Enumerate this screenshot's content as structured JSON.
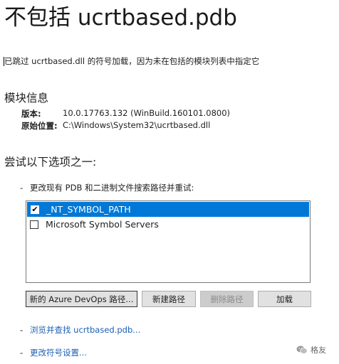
{
  "header": {
    "title": "不包括 ucrtbased.pdb"
  },
  "description": "已跳过 ucrtbased.dll 的符号加载，因为未在包括的模块列表中指定它",
  "module_info": {
    "heading": "模块信息",
    "version_label": "版本:",
    "version_value": "10.0.17763.132 (WinBuild.160101.0800)",
    "location_label": "原始位置:",
    "location_value": "C:\\Windows\\System32\\ucrtbased.dll"
  },
  "options": {
    "heading": "尝试以下选项之一:",
    "bullet_dash": "-",
    "change_paths_text": "更改现有 PDB 和二进制文件搜索路径并重试:",
    "list_items": [
      {
        "label": "_NT_SYMBOL_PATH",
        "checked": true,
        "check_glyph": "✔"
      },
      {
        "label": "Microsoft Symbol Servers",
        "checked": false,
        "check_glyph": ""
      }
    ],
    "buttons": {
      "new_azure": "新的 Azure DevOps 路径...",
      "new_path": "新建路径",
      "delete_path": "删除路径",
      "load": "加载"
    },
    "browse_link": "浏览并查找 ucrtbased.pdb...",
    "symbol_settings_link": "更改符号设置..."
  },
  "watermark": {
    "text": "格友",
    "icon": "wechat-icon"
  },
  "colors": {
    "selection": "#0078d7",
    "link": "#1a5fb4"
  }
}
